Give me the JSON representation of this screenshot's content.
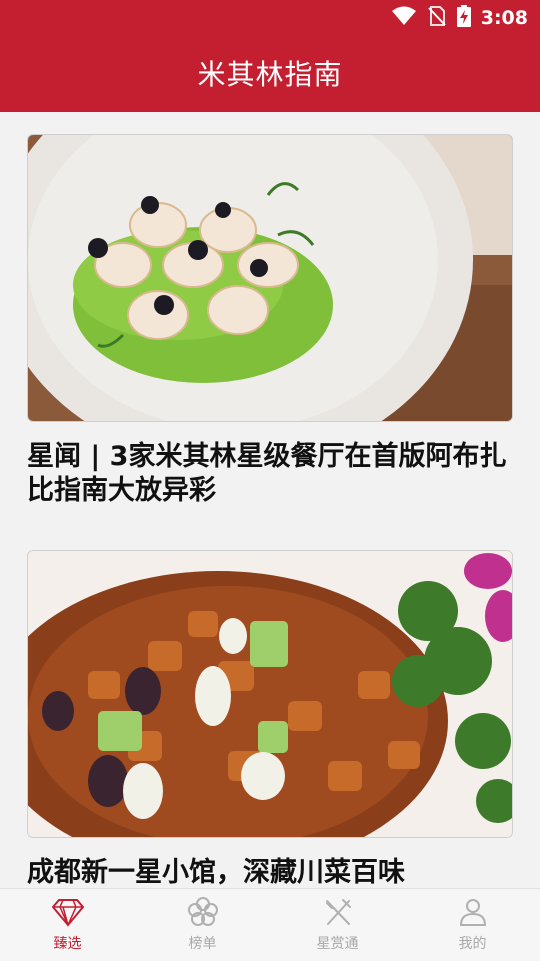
{
  "status_bar": {
    "time": "3:08",
    "icons": [
      "wifi-icon",
      "no-sim-icon",
      "battery-charging-icon"
    ]
  },
  "app_bar": {
    "title": "米其林指南"
  },
  "articles": [
    {
      "headline": "星闻 | 3家米其林星级餐厅在首版阿布扎比指南大放异彩",
      "image": "plated-seafood-dish-photo"
    },
    {
      "headline": "成都新一星小馆，深藏川菜百味",
      "image": "sichuan-stir-fry-photo"
    }
  ],
  "tabs": [
    {
      "label": "臻选",
      "icon": "diamond-icon",
      "active": true
    },
    {
      "label": "榜单",
      "icon": "flower-icon",
      "active": false
    },
    {
      "label": "星赏通",
      "icon": "fork-knife-icon",
      "active": false
    },
    {
      "label": "我的",
      "icon": "person-icon",
      "active": false
    }
  ],
  "colors": {
    "brand": "#c41e31",
    "tab_inactive": "#a8a8a8",
    "background": "#f2f2f2"
  }
}
